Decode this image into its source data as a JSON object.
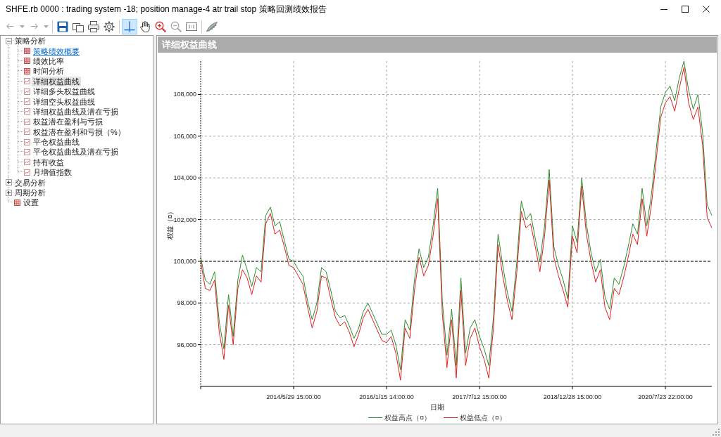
{
  "window": {
    "title": "SHFE.rb 0000 : trading system -18; position manage-4 atr trail stop 策略回测绩效报告"
  },
  "toolbar": {
    "items": [
      {
        "kind": "button",
        "selected": false,
        "disabled": true
      },
      {
        "kind": "dropdown",
        "disabled": true
      },
      {
        "kind": "button",
        "selected": false,
        "disabled": true
      },
      {
        "kind": "dropdown",
        "disabled": true
      },
      {
        "kind": "separator"
      },
      {
        "kind": "button",
        "selected": false,
        "disabled": false
      },
      {
        "kind": "button",
        "selected": false,
        "disabled": false
      },
      {
        "kind": "button",
        "selected": false,
        "disabled": false
      },
      {
        "kind": "button",
        "selected": false,
        "disabled": false
      },
      {
        "kind": "separator"
      },
      {
        "kind": "button",
        "selected": true,
        "disabled": false
      },
      {
        "kind": "button",
        "selected": false,
        "disabled": false
      },
      {
        "kind": "button",
        "selected": false,
        "disabled": false
      },
      {
        "kind": "button",
        "selected": false,
        "disabled": true
      },
      {
        "kind": "button",
        "selected": false,
        "disabled": false
      },
      {
        "kind": "separator"
      },
      {
        "kind": "button",
        "selected": false,
        "disabled": false
      }
    ]
  },
  "tree": {
    "items": [
      {
        "label": "策略分析",
        "kind": "folder",
        "expanded": true,
        "selected": false,
        "hovered": false,
        "children": [
          {
            "label": "策略绩效概要",
            "kind": "table",
            "selected": false,
            "hovered": true
          },
          {
            "label": "绩效比率",
            "kind": "table",
            "selected": false,
            "hovered": false
          },
          {
            "label": "时间分析",
            "kind": "table",
            "selected": false,
            "hovered": false
          },
          {
            "label": "详细权益曲线",
            "kind": "chart",
            "selected": true,
            "hovered": false
          },
          {
            "label": "详细多头权益曲线",
            "kind": "chart",
            "selected": false,
            "hovered": false
          },
          {
            "label": "详细空头权益曲线",
            "kind": "chart",
            "selected": false,
            "hovered": false
          },
          {
            "label": "详细权益曲线及潜在亏损",
            "kind": "chart",
            "selected": false,
            "hovered": false
          },
          {
            "label": "权益潜在盈利与亏损",
            "kind": "chart",
            "selected": false,
            "hovered": false
          },
          {
            "label": "权益潜在盈利和亏损（%）",
            "kind": "chart",
            "selected": false,
            "hovered": false
          },
          {
            "label": "平仓权益曲线",
            "kind": "chart",
            "selected": false,
            "hovered": false
          },
          {
            "label": "平仓权益曲线及潜在亏损",
            "kind": "chart",
            "selected": false,
            "hovered": false
          },
          {
            "label": "持有收益",
            "kind": "chart",
            "selected": false,
            "hovered": false
          },
          {
            "label": "月增值指数",
            "kind": "chart",
            "selected": false,
            "hovered": false
          }
        ]
      },
      {
        "label": "交易分析",
        "kind": "folder",
        "expanded": false,
        "selected": false,
        "hovered": false
      },
      {
        "label": "周期分析",
        "kind": "folder",
        "expanded": false,
        "selected": false,
        "hovered": false
      },
      {
        "label": "设置",
        "kind": "table",
        "selected": false,
        "hovered": false
      }
    ]
  },
  "panel": {
    "title": "详细权益曲线",
    "chart_data": {
      "type": "line",
      "xlabel": "日期",
      "ylabel": "权益（¤）",
      "categories": [
        null,
        null,
        null,
        null,
        null,
        null,
        null,
        null,
        null,
        null,
        null,
        null,
        null,
        null,
        null,
        null,
        null,
        null,
        null,
        null,
        "2014/5/29 15:00:00",
        null,
        null,
        null,
        null,
        null,
        null,
        null,
        null,
        null,
        null,
        null,
        null,
        null,
        null,
        null,
        null,
        null,
        null,
        null,
        "2016/1/15 14:00:00",
        null,
        null,
        null,
        null,
        null,
        null,
        null,
        null,
        null,
        null,
        null,
        null,
        null,
        null,
        null,
        null,
        null,
        null,
        null,
        "2017/7/12 15:00:00",
        null,
        null,
        null,
        null,
        null,
        null,
        null,
        null,
        null,
        null,
        null,
        null,
        null,
        null,
        null,
        null,
        null,
        null,
        null,
        "2018/12/28 15:00:00",
        null,
        null,
        null,
        null,
        null,
        null,
        null,
        null,
        null,
        null,
        null,
        null,
        null,
        null,
        null,
        null,
        null,
        null,
        null,
        "2020/7/23 22:00:00",
        null,
        null,
        null,
        null,
        null,
        null,
        null,
        null,
        null,
        null
      ],
      "series": [
        {
          "name": "权益高点（¤）",
          "color": "#2e8b2e",
          "values": [
            100200,
            99100,
            98900,
            99500,
            97100,
            95800,
            98400,
            96400,
            99100,
            100300,
            99600,
            98800,
            99700,
            99500,
            102200,
            102600,
            101700,
            101900,
            101000,
            100100,
            100000,
            99600,
            99300,
            98100,
            97200,
            98000,
            99700,
            99500,
            98600,
            97600,
            97300,
            97400,
            96900,
            96300,
            96800,
            97600,
            98000,
            97500,
            97000,
            96500,
            96500,
            96700,
            96000,
            94800,
            97200,
            96700,
            99100,
            100600,
            99700,
            100200,
            101700,
            103500,
            98100,
            95500,
            97700,
            95000,
            99200,
            95600,
            96800,
            97200,
            96400,
            95800,
            95000,
            97300,
            101300,
            99800,
            98500,
            97600,
            99900,
            102900,
            102000,
            102300,
            101100,
            100000,
            101700,
            104400,
            100700,
            99800,
            99100,
            98200,
            101700,
            100900,
            104000,
            101800,
            100400,
            99500,
            100100,
            98300,
            97700,
            99200,
            98900,
            99700,
            100700,
            101800,
            101300,
            103500,
            101700,
            103200,
            105300,
            107400,
            108100,
            108400,
            107700,
            108800,
            109600,
            108200,
            107300,
            108000,
            106200,
            102700,
            102200
          ]
        },
        {
          "name": "权益低点（¤）",
          "color": "#e02020",
          "values": [
            100000,
            98700,
            98600,
            99100,
            96600,
            95300,
            97900,
            96000,
            98700,
            99600,
            99200,
            98400,
            99300,
            99000,
            101800,
            102300,
            101300,
            101500,
            100700,
            99800,
            99700,
            99300,
            98900,
            97800,
            96800,
            97600,
            99300,
            99200,
            98200,
            97300,
            96900,
            97100,
            96600,
            95900,
            96500,
            97300,
            97700,
            97200,
            96700,
            96200,
            96100,
            96400,
            95600,
            94300,
            96800,
            96300,
            98600,
            100200,
            99300,
            99800,
            101200,
            103000,
            97500,
            94900,
            97200,
            94400,
            98600,
            95000,
            96300,
            96800,
            95900,
            95300,
            94400,
            96800,
            100800,
            99300,
            98100,
            97200,
            99400,
            102400,
            101600,
            101800,
            100700,
            99500,
            101200,
            103900,
            100200,
            99300,
            98600,
            97800,
            101200,
            100400,
            103600,
            101300,
            100000,
            99000,
            99600,
            97800,
            97200,
            98700,
            98400,
            99200,
            100200,
            101300,
            100800,
            103000,
            101200,
            102700,
            104800,
            106900,
            107600,
            107900,
            107200,
            108300,
            109300,
            107600,
            106800,
            107400,
            105600,
            102100,
            101600
          ]
        }
      ],
      "ylim": [
        94000,
        109600
      ],
      "yticks": [
        {
          "value": 96000,
          "label": "96,000"
        },
        {
          "value": 98000,
          "label": "98,000"
        },
        {
          "value": 100000,
          "label": "100,000"
        },
        {
          "value": 102000,
          "label": "102,000"
        },
        {
          "value": 104000,
          "label": "104,000"
        },
        {
          "value": 106000,
          "label": "106,000"
        },
        {
          "value": 108000,
          "label": "108,000"
        }
      ],
      "grid": true,
      "legend": "bottom",
      "ref_lines": [
        {
          "axis": "y",
          "value": 100000
        }
      ]
    }
  }
}
